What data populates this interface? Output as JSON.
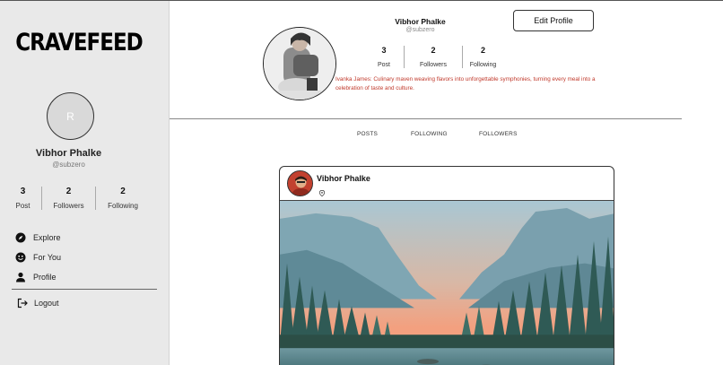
{
  "brand": "CRAVEFEED",
  "sidebar": {
    "avatar_letter": "R",
    "name": "Vibhor Phalke",
    "handle": "@subzero",
    "stats": [
      {
        "num": "3",
        "label": "Post"
      },
      {
        "num": "2",
        "label": "Followers"
      },
      {
        "num": "2",
        "label": "Following"
      }
    ],
    "nav": [
      {
        "label": "Explore",
        "icon": "compass-icon"
      },
      {
        "label": "For You",
        "icon": "smiley-icon"
      },
      {
        "label": "Profile",
        "icon": "person-icon"
      }
    ],
    "logout": "Logout"
  },
  "profile": {
    "name": "Vibhor Phalke",
    "handle": "@subzero",
    "edit_label": "Edit Profile",
    "stats": [
      {
        "num": "3",
        "label": "Post"
      },
      {
        "num": "2",
        "label": "Followers"
      },
      {
        "num": "2",
        "label": "Following"
      }
    ],
    "bio": "Ivanka James: Culinary maven weaving flavors into unforgettable symphonies, turning every meal into a celebration of taste and culture."
  },
  "tabs": [
    "POSTS",
    "FOLLOWING",
    "FOLLOWERS"
  ],
  "post": {
    "author": "Vibhor Phalke",
    "location_icon": "location-pin-icon"
  },
  "colors": {
    "bio": "#c0392b",
    "sidebar_bg": "#e9e9e9"
  }
}
